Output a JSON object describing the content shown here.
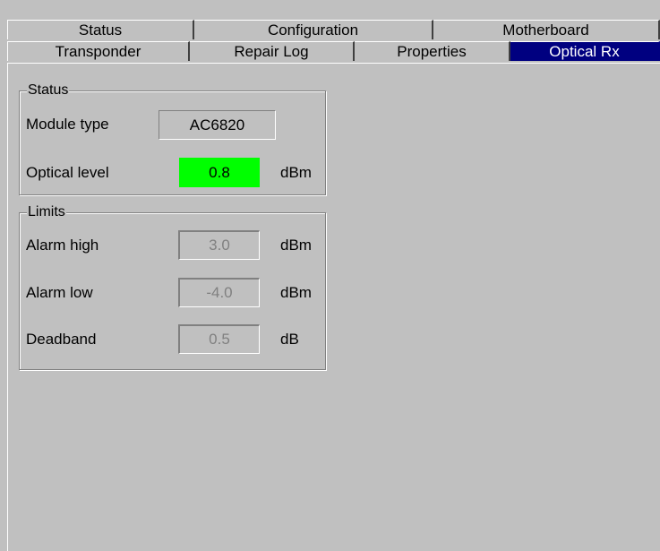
{
  "tabs": {
    "row1": [
      {
        "label": "Status"
      },
      {
        "label": "Configuration"
      },
      {
        "label": "Motherboard"
      }
    ],
    "row2": [
      {
        "label": "Transponder"
      },
      {
        "label": "Repair Log"
      },
      {
        "label": "Properties"
      },
      {
        "label": "Optical Rx"
      }
    ],
    "active": "Optical Rx"
  },
  "status_group": {
    "title": "Status",
    "module_type_label": "Module type",
    "module_type_value": "AC6820",
    "optical_level_label": "Optical level",
    "optical_level_value": "0.8",
    "optical_level_unit": "dBm",
    "optical_level_color": "#00ff00"
  },
  "limits_group": {
    "title": "Limits",
    "alarm_high_label": "Alarm high",
    "alarm_high_value": "3.0",
    "alarm_high_unit": "dBm",
    "alarm_low_label": "Alarm low",
    "alarm_low_value": "-4.0",
    "alarm_low_unit": "dBm",
    "deadband_label": "Deadband",
    "deadband_value": "0.5",
    "deadband_unit": "dB"
  },
  "colors": {
    "active_tab_bg": "#000080",
    "background": "#c0c0c0"
  }
}
